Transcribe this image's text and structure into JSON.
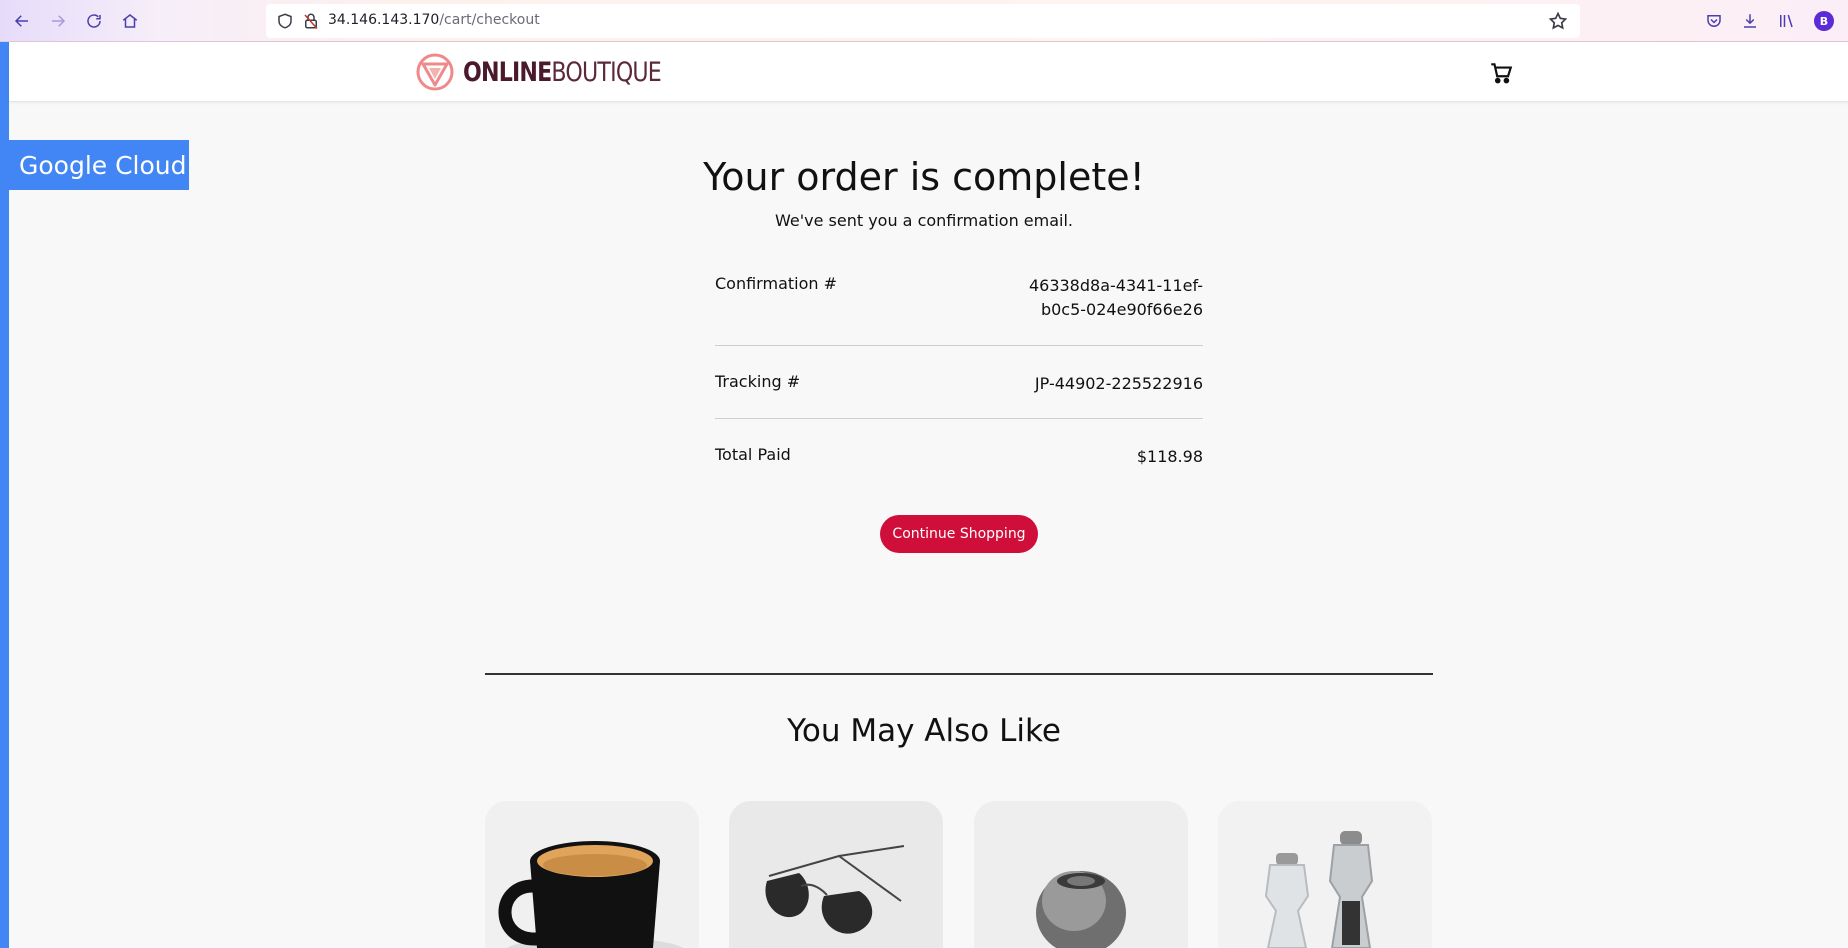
{
  "browser": {
    "url_host": "34.146.143.170",
    "url_path": "/cart/checkout",
    "profile_initial": "B"
  },
  "header": {
    "logo_bold": "ONLINE",
    "logo_light": "BOUTIQUE"
  },
  "badge": {
    "label": "Google Cloud"
  },
  "order": {
    "title": "Your order is complete!",
    "subtitle": "We've sent you a confirmation email.",
    "rows": [
      {
        "label": "Confirmation #",
        "value_line1": "46338d8a-4341-11ef-",
        "value_line2": "b0c5-024e90f66e26"
      },
      {
        "label": "Tracking #",
        "value_line1": "JP-44902-225522916"
      },
      {
        "label": "Total Paid",
        "value_line1": "$118.98"
      }
    ],
    "continue_label": "Continue Shopping"
  },
  "recommendations": {
    "title": "You May Also Like",
    "products": [
      {
        "icon": "mug-image"
      },
      {
        "icon": "sunglasses-image"
      },
      {
        "icon": "candle-holder-image"
      },
      {
        "icon": "salt-pepper-shakers-image"
      }
    ]
  },
  "colors": {
    "accent": "#cf0f3a",
    "google_blue": "#4285f4",
    "logo_color": "#4a1a2c"
  }
}
